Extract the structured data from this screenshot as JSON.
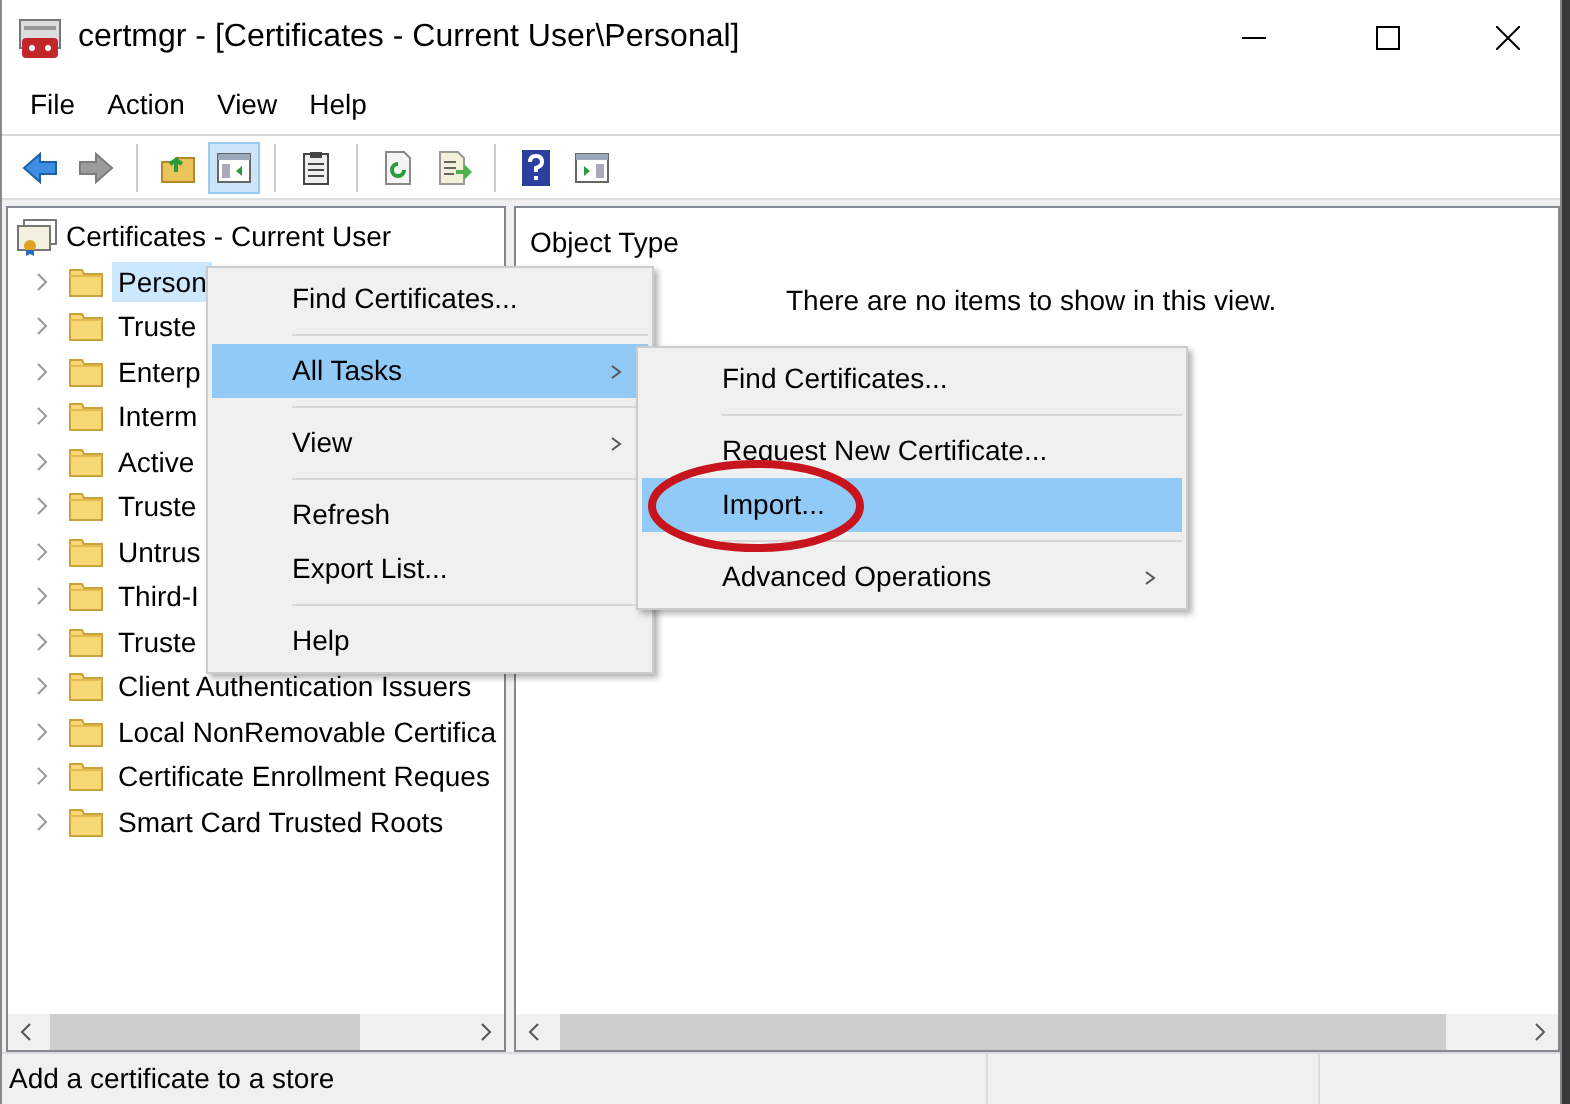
{
  "window": {
    "title": "certmgr - [Certificates - Current User\\Personal]"
  },
  "menu_bar": [
    "File",
    "Action",
    "View",
    "Help"
  ],
  "toolbar": [
    {
      "kind": "back",
      "disabled": false,
      "pressed": false
    },
    {
      "kind": "forward",
      "disabled": true,
      "pressed": false
    },
    {
      "kind": "separator"
    },
    {
      "kind": "up",
      "disabled": false,
      "pressed": false
    },
    {
      "kind": "tree-toggle",
      "disabled": false,
      "pressed": true
    },
    {
      "kind": "separator"
    },
    {
      "kind": "properties",
      "disabled": false,
      "pressed": false
    },
    {
      "kind": "separator"
    },
    {
      "kind": "refresh",
      "disabled": false,
      "pressed": false
    },
    {
      "kind": "export",
      "disabled": false,
      "pressed": false
    },
    {
      "kind": "separator"
    },
    {
      "kind": "help",
      "disabled": false,
      "pressed": false
    },
    {
      "kind": "action-pane",
      "disabled": false,
      "pressed": false
    }
  ],
  "tree": {
    "label": "Certificates - Current User",
    "children": [
      {
        "label": "Person",
        "selected": true
      },
      {
        "label": "Truste",
        "selected": false
      },
      {
        "label": "Enterp",
        "selected": false
      },
      {
        "label": "Interm",
        "selected": false
      },
      {
        "label": "Active",
        "selected": false
      },
      {
        "label": "Truste",
        "selected": false
      },
      {
        "label": "Untrus",
        "selected": false
      },
      {
        "label": "Third-I",
        "selected": false
      },
      {
        "label": "Truste",
        "selected": false
      },
      {
        "label": "Client Authentication Issuers",
        "selected": false
      },
      {
        "label": "Local NonRemovable Certifica",
        "selected": false
      },
      {
        "label": "Certificate Enrollment Reques",
        "selected": false
      },
      {
        "label": "Smart Card Trusted Roots",
        "selected": false
      }
    ]
  },
  "list": {
    "columns": [
      "Object Type"
    ],
    "empty_message": "There are no items to show in this view."
  },
  "context_menu": [
    {
      "label": "Find Certificates...",
      "selected": false,
      "submenu": false
    },
    {
      "kind": "separator"
    },
    {
      "label": "All Tasks",
      "selected": true,
      "submenu": true
    },
    {
      "kind": "separator"
    },
    {
      "label": "View",
      "selected": false,
      "submenu": true
    },
    {
      "kind": "separator"
    },
    {
      "label": "Refresh",
      "selected": false,
      "submenu": false
    },
    {
      "label": "Export List...",
      "selected": false,
      "submenu": false
    },
    {
      "kind": "separator"
    },
    {
      "label": "Help",
      "selected": false,
      "submenu": false
    }
  ],
  "submenu": [
    {
      "label": "Find Certificates...",
      "selected": false,
      "submenu": false,
      "circled": false
    },
    {
      "kind": "separator"
    },
    {
      "label": "Request New Certificate...",
      "selected": false,
      "submenu": false,
      "circled": false
    },
    {
      "label": "Import...",
      "selected": true,
      "submenu": false,
      "circled": true
    },
    {
      "kind": "separator"
    },
    {
      "label": "Advanced Operations",
      "selected": false,
      "submenu": true,
      "circled": false
    }
  ],
  "status_bar": {
    "text": "Add a certificate to a store"
  }
}
